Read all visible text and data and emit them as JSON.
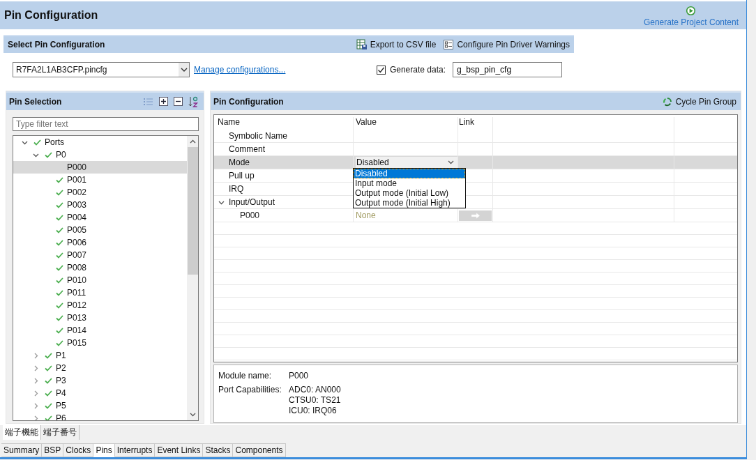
{
  "header": {
    "title": "Pin Configuration",
    "action": "Generate Project Content"
  },
  "select_bar": {
    "title": "Select Pin Configuration",
    "buttons": [
      "Export to CSV file",
      "Configure Pin Driver Warnings"
    ]
  },
  "config_row": {
    "file": "R7FA2L1AB3CFP.pincfg",
    "manage_link": "Manage configurations...",
    "generate_data": {
      "label": "Generate data:",
      "checked": true
    },
    "data_name": "g_bsp_pin_cfg"
  },
  "pin_selection": {
    "title": "Pin Selection",
    "filter_placeholder": "Type filter text",
    "tree": [
      {
        "label": "Ports",
        "checked": true,
        "expanded": true,
        "selected": false,
        "children": [
          {
            "label": "P0",
            "checked": true,
            "expanded": true,
            "selected": false,
            "children": [
              {
                "label": "P000",
                "checked": false,
                "selected": true
              },
              {
                "label": "P001",
                "checked": true,
                "selected": false
              },
              {
                "label": "P002",
                "checked": true,
                "selected": false
              },
              {
                "label": "P003",
                "checked": true,
                "selected": false
              },
              {
                "label": "P004",
                "checked": true,
                "selected": false
              },
              {
                "label": "P005",
                "checked": true,
                "selected": false
              },
              {
                "label": "P006",
                "checked": true,
                "selected": false
              },
              {
                "label": "P007",
                "checked": true,
                "selected": false
              },
              {
                "label": "P008",
                "checked": true,
                "selected": false
              },
              {
                "label": "P010",
                "checked": true,
                "selected": false
              },
              {
                "label": "P011",
                "checked": true,
                "selected": false
              },
              {
                "label": "P012",
                "checked": true,
                "selected": false
              },
              {
                "label": "P013",
                "checked": true,
                "selected": false
              },
              {
                "label": "P014",
                "checked": true,
                "selected": false
              },
              {
                "label": "P015",
                "checked": true,
                "selected": false
              }
            ]
          },
          {
            "label": "P1",
            "checked": true,
            "expanded": false,
            "selected": false
          },
          {
            "label": "P2",
            "checked": true,
            "expanded": false,
            "selected": false
          },
          {
            "label": "P3",
            "checked": true,
            "expanded": false,
            "selected": false
          },
          {
            "label": "P4",
            "checked": true,
            "expanded": false,
            "selected": false
          },
          {
            "label": "P5",
            "checked": true,
            "expanded": false,
            "selected": false
          },
          {
            "label": "P6",
            "checked": true,
            "expanded": false,
            "selected": false
          }
        ]
      }
    ],
    "view_tabs": [
      {
        "label": "端子機能",
        "selected": true
      },
      {
        "label": "端子番号",
        "selected": false
      }
    ]
  },
  "pin_configuration": {
    "title": "Pin Configuration",
    "action": "Cycle Pin Group",
    "columns": [
      "Name",
      "Value",
      "Link"
    ],
    "rows": [
      {
        "name": "Symbolic Name",
        "selected": false
      },
      {
        "name": "Comment",
        "selected": false
      },
      {
        "name": "Mode",
        "value": "Disabled",
        "selected": true,
        "options": [
          {
            "label": "Disabled",
            "selected": true
          },
          {
            "label": "Input mode",
            "selected": false
          },
          {
            "label": "Output mode (Initial Low)",
            "selected": false
          },
          {
            "label": "Output mode (Initial High)",
            "selected": false
          }
        ]
      },
      {
        "name": "Pull up",
        "selected": false
      },
      {
        "name": "IRQ",
        "selected": false
      },
      {
        "name": "Input/Output",
        "expanded": true,
        "selected": false,
        "children": [
          {
            "name": "P000",
            "value": "None",
            "selected": false,
            "disabled": true
          }
        ]
      }
    ],
    "info": {
      "module_label": "Module name:",
      "module_value": "P000",
      "capabilities_label": "Port Capabilities:",
      "capabilities": [
        "ADC0: AN000",
        "CTSU0: TS21",
        "ICU0: IRQ06"
      ]
    }
  },
  "editor_tabs": [
    {
      "label": "Summary",
      "selected": false
    },
    {
      "label": "BSP",
      "selected": false
    },
    {
      "label": "Clocks",
      "selected": false
    },
    {
      "label": "Pins",
      "selected": true
    },
    {
      "label": "Interrupts",
      "selected": false
    },
    {
      "label": "Event Links",
      "selected": false
    },
    {
      "label": "Stacks",
      "selected": false
    },
    {
      "label": "Components",
      "selected": false
    }
  ]
}
